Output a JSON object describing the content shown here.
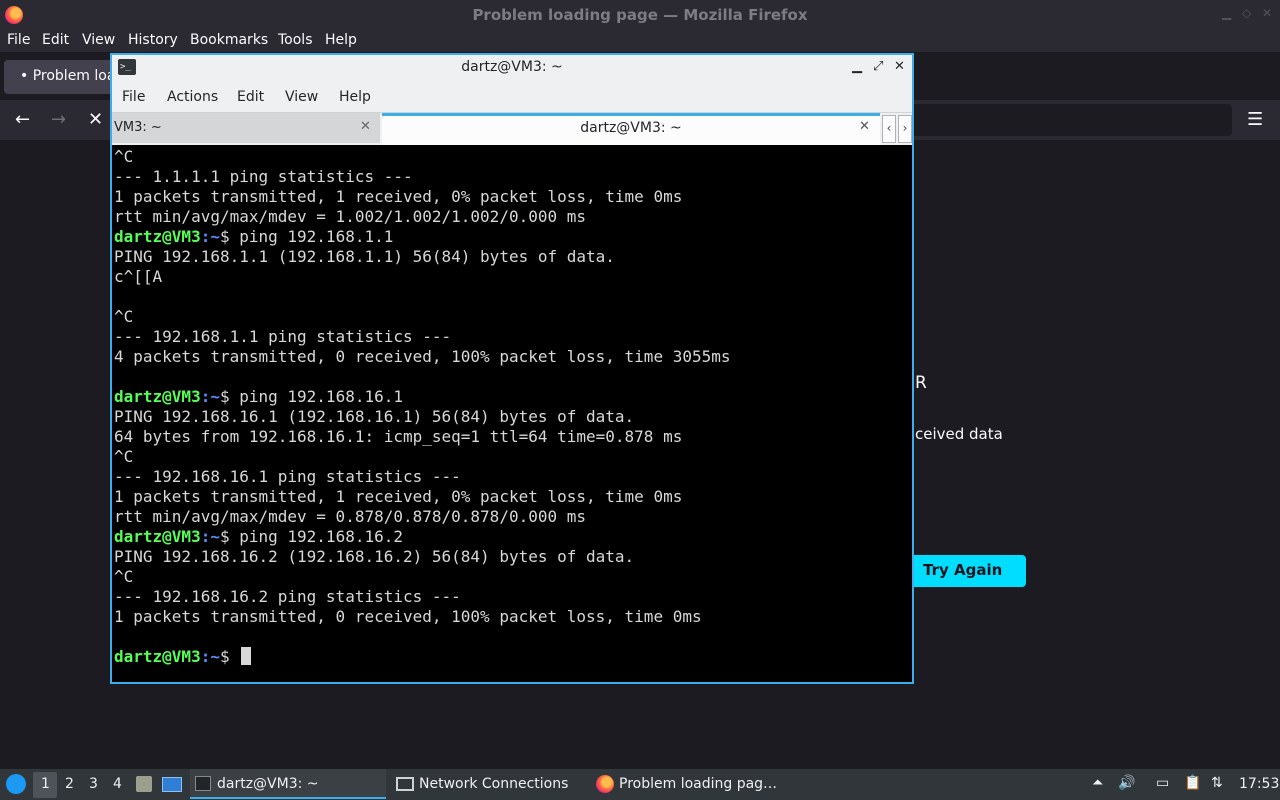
{
  "firefox": {
    "window_title": "Problem loading page — Mozilla Firefox",
    "menu": [
      "File",
      "Edit",
      "View",
      "History",
      "Bookmarks",
      "Tools",
      "Help"
    ],
    "tab_label": "• Problem loa",
    "error_fragment_1": "R",
    "error_fragment_2": "ceived data",
    "try_again_label": "Try Again"
  },
  "terminal": {
    "window_title": "dartz@VM3: ~",
    "menu": [
      "File",
      "Actions",
      "Edit",
      "View",
      "Help"
    ],
    "tabs": [
      {
        "label": "VM3: ~",
        "active": false
      },
      {
        "label": "dartz@VM3: ~",
        "active": true
      }
    ],
    "prompt_user": "dartz@VM3",
    "prompt_path": ":~",
    "prompt_symbol": "$ ",
    "lines": [
      {
        "type": "out",
        "text": "^C"
      },
      {
        "type": "out",
        "text": "--- 1.1.1.1 ping statistics ---"
      },
      {
        "type": "out",
        "text": "1 packets transmitted, 1 received, 0% packet loss, time 0ms"
      },
      {
        "type": "out",
        "text": "rtt min/avg/max/mdev = 1.002/1.002/1.002/0.000 ms"
      },
      {
        "type": "cmd",
        "text": "ping 192.168.1.1"
      },
      {
        "type": "out",
        "text": "PING 192.168.1.1 (192.168.1.1) 56(84) bytes of data."
      },
      {
        "type": "out",
        "text": "c^[[A"
      },
      {
        "type": "out",
        "text": ""
      },
      {
        "type": "out",
        "text": "^C"
      },
      {
        "type": "out",
        "text": "--- 192.168.1.1 ping statistics ---"
      },
      {
        "type": "out",
        "text": "4 packets transmitted, 0 received, 100% packet loss, time 3055ms"
      },
      {
        "type": "out",
        "text": ""
      },
      {
        "type": "cmd",
        "text": "ping 192.168.16.1"
      },
      {
        "type": "out",
        "text": "PING 192.168.16.1 (192.168.16.1) 56(84) bytes of data."
      },
      {
        "type": "out",
        "text": "64 bytes from 192.168.16.1: icmp_seq=1 ttl=64 time=0.878 ms"
      },
      {
        "type": "out",
        "text": "^C"
      },
      {
        "type": "out",
        "text": "--- 192.168.16.1 ping statistics ---"
      },
      {
        "type": "out",
        "text": "1 packets transmitted, 1 received, 0% packet loss, time 0ms"
      },
      {
        "type": "out",
        "text": "rtt min/avg/max/mdev = 0.878/0.878/0.878/0.000 ms"
      },
      {
        "type": "cmd",
        "text": "ping 192.168.16.2"
      },
      {
        "type": "out",
        "text": "PING 192.168.16.2 (192.168.16.2) 56(84) bytes of data."
      },
      {
        "type": "out",
        "text": "^C"
      },
      {
        "type": "out",
        "text": "--- 192.168.16.2 ping statistics ---"
      },
      {
        "type": "out",
        "text": "1 packets transmitted, 0 received, 100% packet loss, time 0ms"
      },
      {
        "type": "out",
        "text": ""
      },
      {
        "type": "prompt",
        "text": ""
      }
    ]
  },
  "taskbar": {
    "workspaces": [
      "1",
      "2",
      "3",
      "4"
    ],
    "tasks": {
      "terminal": "dartz@VM3: ~",
      "network": "Network Connections",
      "firefox": "Problem loading pag…"
    },
    "clock": "17:53"
  },
  "colors": {
    "accent": "#3daee9",
    "prompt_user": "#55ff55",
    "prompt_path": "#5c8dff",
    "try_again_bg": "#00ddff"
  }
}
